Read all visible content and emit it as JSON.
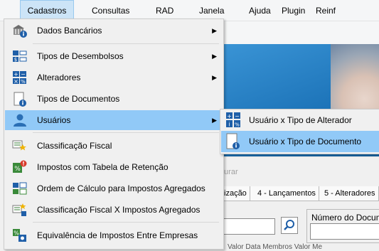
{
  "menubar": {
    "items": [
      "Cadastros",
      "Consultas",
      "RAD",
      "Janela",
      "Ajuda",
      "Plugin",
      "Reinf"
    ]
  },
  "background": {
    "scan_label": "turar",
    "tabs": [
      "bilização",
      "4 - Lançamentos",
      "5 - Alteradores"
    ],
    "field_label": "Número do Docum",
    "bottom_text": "Valor Data Membros     Valor Me"
  },
  "cadastros_menu": {
    "items": [
      {
        "label": "Dados Bancários",
        "icon": "bank-info-icon",
        "submenu": true
      },
      {
        "label": "Tipos de Desembolsos",
        "icon": "disbursement-types-icon",
        "submenu": true
      },
      {
        "label": "Alteradores",
        "icon": "calculator-icon",
        "submenu": true
      },
      {
        "label": "Tipos de Documentos",
        "icon": "document-info-icon",
        "submenu": false
      },
      {
        "label": "Usuários",
        "icon": "user-icon",
        "submenu": true
      },
      {
        "label": "Classificação Fiscal",
        "icon": "fiscal-classification-icon",
        "submenu": false
      },
      {
        "label": "Impostos com Tabela de Retenção",
        "icon": "tax-retention-icon",
        "submenu": false
      },
      {
        "label": "Ordem de Cálculo para Impostos Agregados",
        "icon": "calculation-order-icon",
        "submenu": false
      },
      {
        "label": "Classificação Fiscal X Impostos Agregados",
        "icon": "fiscal-tax-link-icon",
        "submenu": false
      },
      {
        "label": "Equivalência de Impostos Entre Empresas",
        "icon": "tax-equivalence-icon",
        "submenu": false
      }
    ]
  },
  "usuarios_submenu": {
    "items": [
      {
        "label": "Usuário x Tipo de Alterador",
        "icon": "calculator-info-icon"
      },
      {
        "label": "Usuário x Tipo de Documento",
        "icon": "document-info-icon"
      }
    ]
  },
  "colors": {
    "highlight": "#91c9f7",
    "menu_bg": "#f0f0f0",
    "icon_blue": "#1f5fa8"
  }
}
